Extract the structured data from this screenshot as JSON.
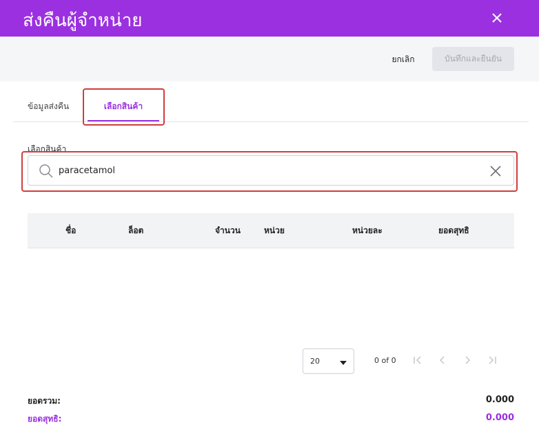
{
  "colors": {
    "accent": "#9b30e0",
    "highlight": "#cf3d3d"
  },
  "header": {
    "title": "ส่งคืนผู้จำหน่าย",
    "close_icon": "close-icon"
  },
  "actions": {
    "cancel_label": "ยกเลิก",
    "save_label": "บันทึกและยืนยัน"
  },
  "tabs": [
    {
      "label": "ข้อมูลส่งคืน",
      "active": false
    },
    {
      "label": "เลือกสินค้า",
      "active": true
    }
  ],
  "search": {
    "label": "เลือกสินค้า",
    "value": "paracetamol",
    "icon": "search-icon",
    "clear_icon": "close-icon"
  },
  "table": {
    "columns": [
      "ชื่อ",
      "ล็อต",
      "จำนวน",
      "หน่วย",
      "หน่วยละ",
      "ยอดสุทธิ"
    ],
    "rows": []
  },
  "pagination": {
    "page_size": "20",
    "info": "0 of 0"
  },
  "totals": {
    "total_label": "ยอดรวม:",
    "total_value": "0.000",
    "net_label": "ยอดสุทธิ:",
    "net_value": "0.000"
  }
}
